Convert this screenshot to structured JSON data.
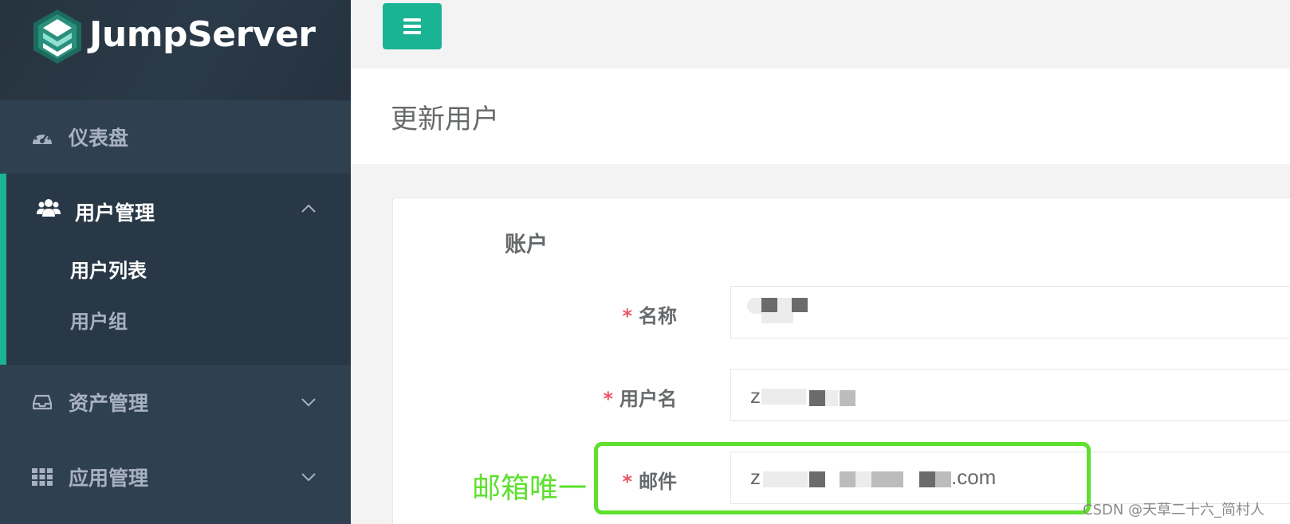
{
  "app": {
    "logo_text": "JumpServer"
  },
  "sidebar": {
    "items": [
      {
        "label": "仪表盘",
        "icon": "dashboard-icon"
      },
      {
        "label": "用户管理",
        "icon": "users-icon",
        "expanded": true,
        "children": [
          {
            "label": "用户列表",
            "active": true
          },
          {
            "label": "用户组",
            "active": false
          }
        ]
      },
      {
        "label": "资产管理",
        "icon": "inbox-icon",
        "expanded": false
      },
      {
        "label": "应用管理",
        "icon": "grid-icon",
        "expanded": false
      }
    ]
  },
  "topbar": {
    "menu_icon": "hamburger-icon"
  },
  "page": {
    "title": "更新用户"
  },
  "form": {
    "section_title": "账户",
    "fields": {
      "name": {
        "label": "名称",
        "required": true,
        "value": ""
      },
      "username": {
        "label": "用户名",
        "required": true,
        "value_prefix": "z",
        "value_suffix": ""
      },
      "email": {
        "label": "邮件",
        "required": true,
        "value_prefix": "z",
        "value_suffix": ".com"
      }
    }
  },
  "annotation": {
    "text": "邮箱唯一",
    "color": "#5ee02e"
  },
  "watermark": "CSDN @天草二十六_简村人",
  "colors": {
    "sidebar_bg": "#2f4050",
    "accent": "#1ab394",
    "required": "#ed5565"
  }
}
